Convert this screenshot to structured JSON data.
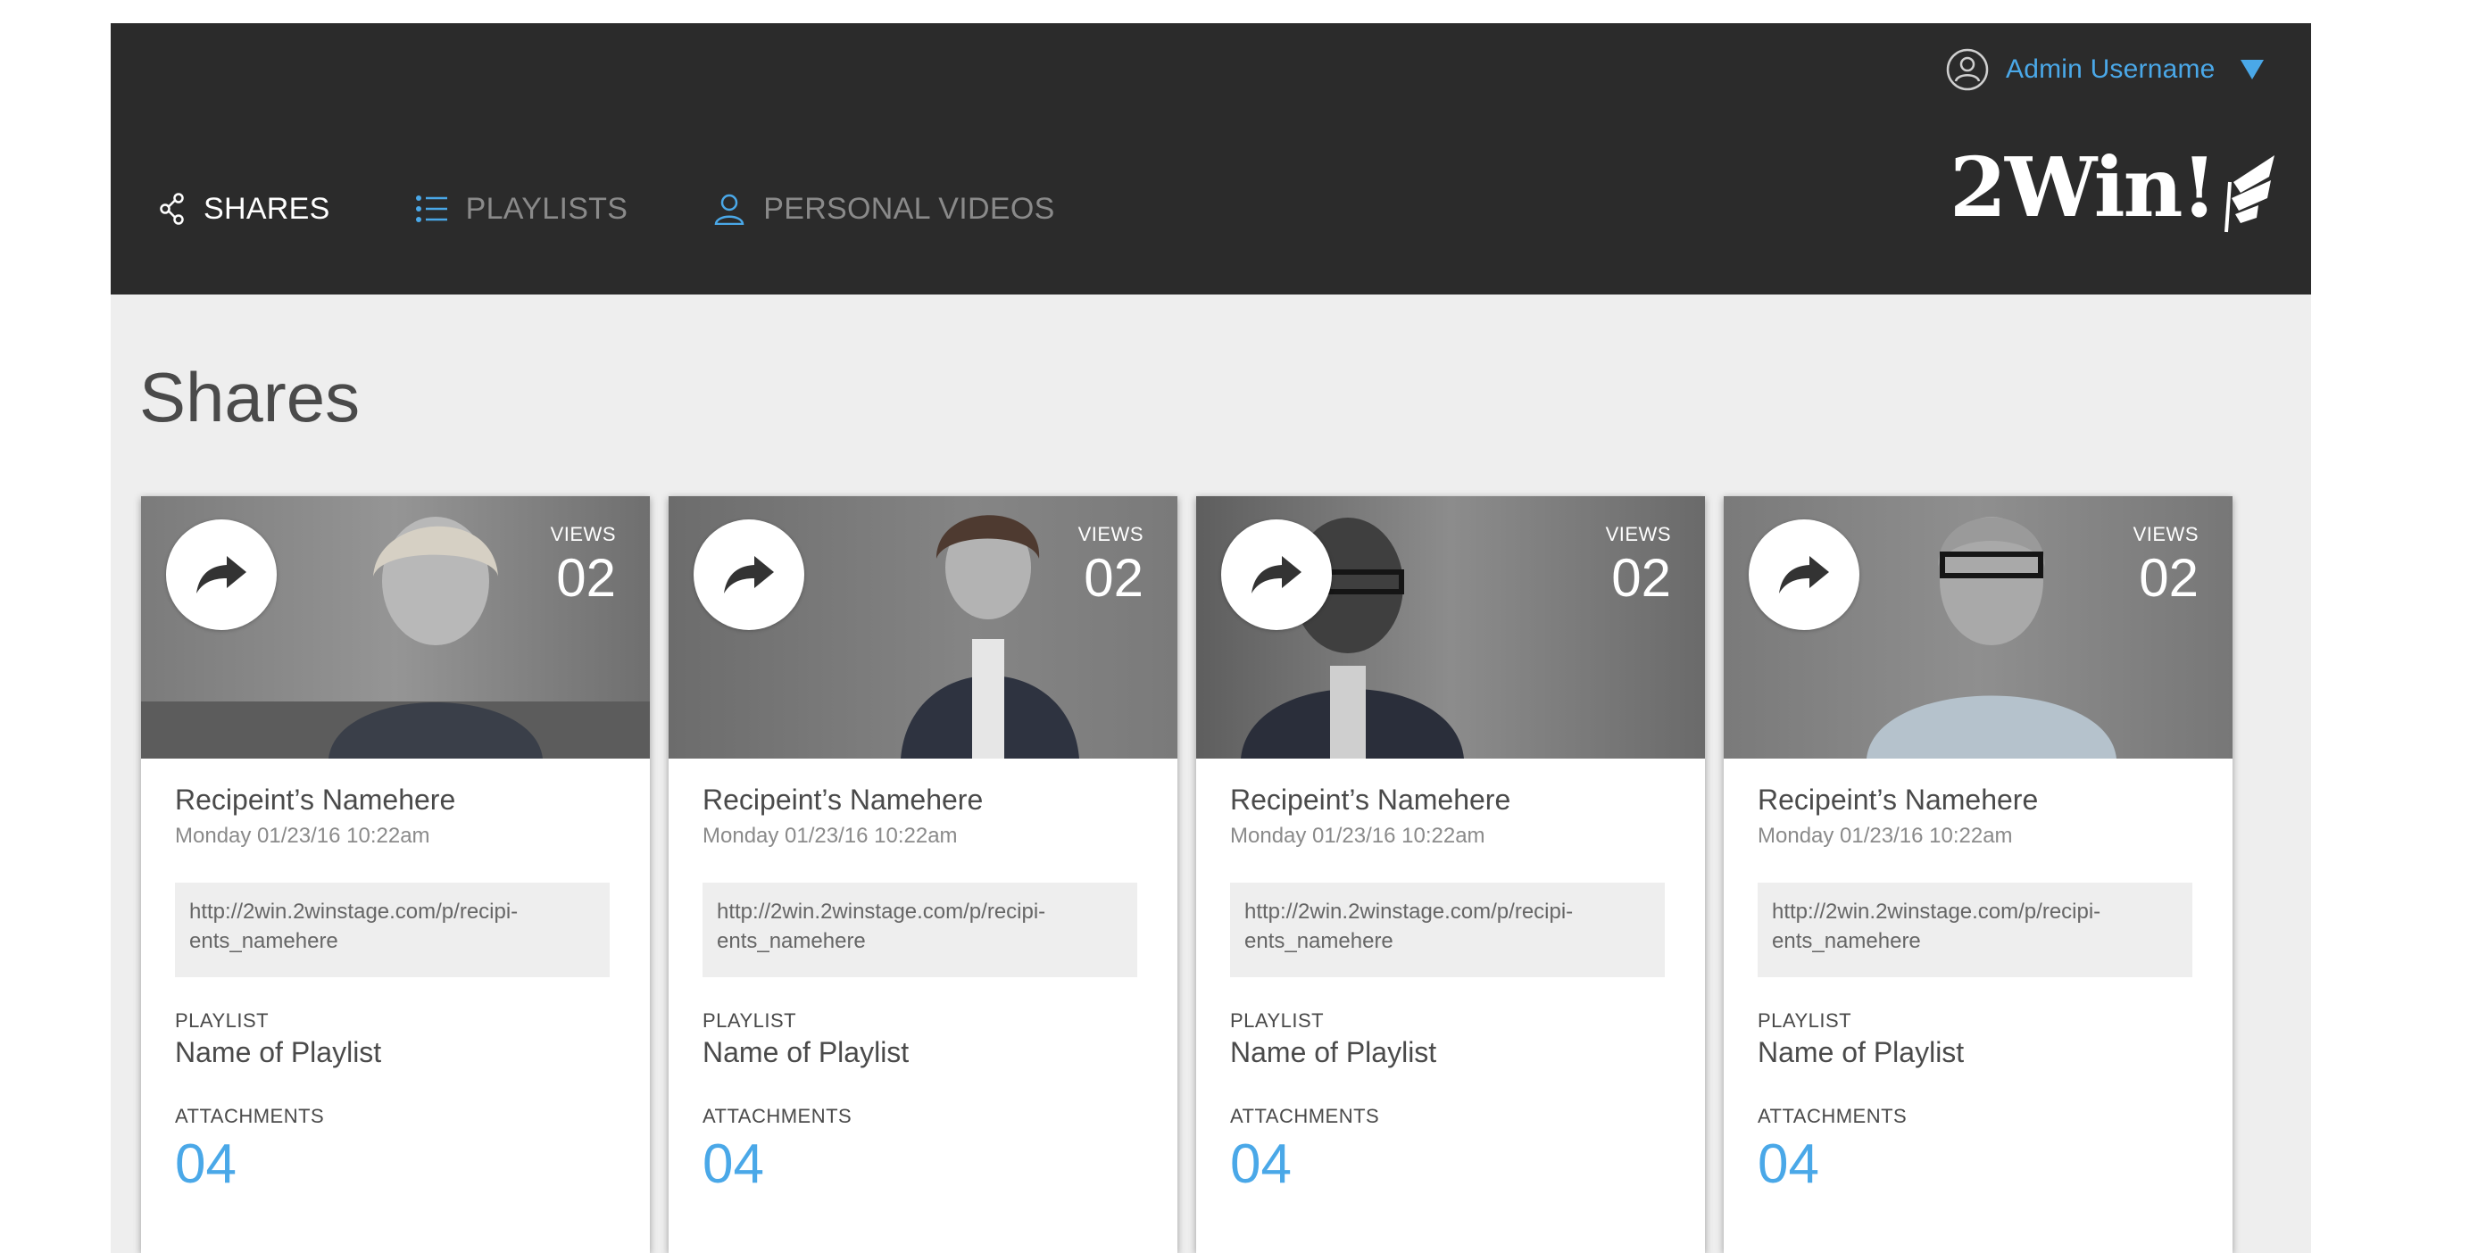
{
  "header": {
    "user": {
      "name": "Admin Username"
    },
    "nav": [
      {
        "label": "SHARES",
        "icon": "share-icon",
        "active": true
      },
      {
        "label": "PLAYLISTS",
        "icon": "list-icon",
        "active": false
      },
      {
        "label": "PERSONAL VIDEOS",
        "icon": "person-icon",
        "active": false
      }
    ],
    "logo_text": "2Win!"
  },
  "page": {
    "title": "Shares"
  },
  "cards": [
    {
      "views_label": "VIEWS",
      "views": "02",
      "recipient": "Recipeint’s Namehere",
      "date": "Monday 01/23/16 10:22am",
      "link_line1": "http://2win.2winstage.com/p/recipi-",
      "link_line2": "ents_namehere",
      "playlist_label": "PLAYLIST",
      "playlist": "Name of Playlist",
      "attachments_label": "ATTACHMENTS",
      "attachments": "04"
    },
    {
      "views_label": "VIEWS",
      "views": "02",
      "recipient": "Recipeint’s Namehere",
      "date": "Monday 01/23/16 10:22am",
      "link_line1": "http://2win.2winstage.com/p/recipi-",
      "link_line2": "ents_namehere",
      "playlist_label": "PLAYLIST",
      "playlist": "Name of Playlist",
      "attachments_label": "ATTACHMENTS",
      "attachments": "04"
    },
    {
      "views_label": "VIEWS",
      "views": "02",
      "recipient": "Recipeint’s Namehere",
      "date": "Monday 01/23/16 10:22am",
      "link_line1": "http://2win.2winstage.com/p/recipi-",
      "link_line2": "ents_namehere",
      "playlist_label": "PLAYLIST",
      "playlist": "Name of Playlist",
      "attachments_label": "ATTACHMENTS",
      "attachments": "04"
    },
    {
      "views_label": "VIEWS",
      "views": "02",
      "recipient": "Recipeint’s Namehere",
      "date": "Monday 01/23/16 10:22am",
      "link_line1": "http://2win.2winstage.com/p/recipi-",
      "link_line2": "ents_namehere",
      "playlist_label": "PLAYLIST",
      "playlist": "Name of Playlist",
      "attachments_label": "ATTACHMENTS",
      "attachments": "04"
    }
  ],
  "colors": {
    "header_bg": "#2b2b2b",
    "page_bg": "#eeeeee",
    "accent": "#4aa8e8",
    "text": "#4a4a4a"
  }
}
